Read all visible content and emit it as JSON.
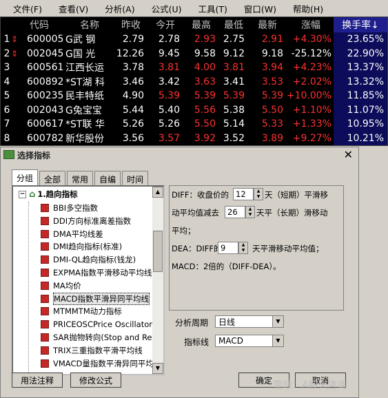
{
  "menu": [
    "文件(F)",
    "查看(V)",
    "分析(A)",
    "公式(U)",
    "工具(T)",
    "窗口(W)",
    "帮助(H)"
  ],
  "quote_table": {
    "headers": [
      "代码",
      "名称",
      "昨收",
      "今开",
      "最高",
      "最低",
      "最新",
      "涨幅",
      "换手率↓"
    ],
    "colors": {
      "up": "#ff3030",
      "down": "#ffffff",
      "green": "#00e000",
      "neutral": "#ffffff",
      "turnover": "#ffffff"
    },
    "rows": [
      {
        "idx": "1",
        "arrow": "⇕",
        "code": "600005",
        "name": "G武 钢",
        "prev": "2.79",
        "open": "2.78",
        "high": "2.93",
        "low": "2.75",
        "last": "2.91",
        "change": "+4.30%",
        "turnover": "23.65%"
      },
      {
        "idx": "2",
        "arrow": "⇕",
        "code": "002045",
        "name": "G国 光",
        "prev": "12.26",
        "open": "9.45",
        "high": "9.58",
        "low": "9.12",
        "last": "9.18",
        "change": "-25.12%",
        "turnover": "22.90%"
      },
      {
        "idx": "3",
        "arrow": "",
        "code": "600561",
        "name": "江西长运",
        "prev": "3.78",
        "open": "3.81",
        "high": "4.00",
        "low": "3.81",
        "last": "3.94",
        "change": "+4.23%",
        "turnover": "13.37%"
      },
      {
        "idx": "4",
        "arrow": "",
        "code": "600892",
        "name": "*ST湖 科",
        "prev": "3.46",
        "open": "3.42",
        "high": "3.63",
        "low": "3.41",
        "last": "3.53",
        "change": "+2.02%",
        "turnover": "13.32%"
      },
      {
        "idx": "5",
        "arrow": "",
        "code": "600235",
        "name": "民丰特纸",
        "prev": "4.90",
        "open": "5.39",
        "high": "5.39",
        "low": "5.39",
        "last": "5.39",
        "change": "+10.00%",
        "turnover": "11.85%"
      },
      {
        "idx": "6",
        "arrow": "",
        "code": "002043",
        "name": "G兔宝宝",
        "prev": "5.44",
        "open": "5.40",
        "high": "5.56",
        "low": "5.38",
        "last": "5.50",
        "change": "+1.10%",
        "turnover": "11.07%"
      },
      {
        "idx": "7",
        "arrow": "",
        "code": "600617",
        "name": "*ST联 华",
        "prev": "5.26",
        "open": "5.26",
        "high": "5.50",
        "low": "5.14",
        "last": "5.33",
        "change": "+1.33%",
        "turnover": "10.95%"
      },
      {
        "idx": "8",
        "arrow": "",
        "code": "600782",
        "name": "新华股份",
        "prev": "3.56",
        "open": "3.57",
        "high": "3.92",
        "low": "3.52",
        "last": "3.89",
        "change": "+9.27%",
        "turnover": "10.21%"
      }
    ]
  },
  "dialog": {
    "title": "选择指标",
    "close": "✕",
    "tabs": [
      "分组",
      "全部",
      "常用",
      "自编",
      "时间"
    ],
    "tree_root": "1.趋向指标",
    "tree_items": [
      "BBI多空指数",
      "DDI方向标准离差指数",
      "DMA平均线差",
      "DMI趋向指标(标准)",
      "DMI-QL趋向指标(钱龙)",
      "EXPMA指数平滑移动平均线",
      "MA均价",
      "MACD指数平滑异同平均线",
      "MTMMTM动力指标",
      "PRICEOSCPrice Oscillator",
      "SAR抛物转向(Stop and Rev",
      "TRIX三重指数平滑平均线",
      "VMACD量指数平滑异同平均线"
    ],
    "selected_item": "MACD指数平滑异同平均线",
    "params": {
      "line1a": "DIFF：收盘价的",
      "short_value": "12",
      "line1b": "天（短期）平滑移",
      "line2a": "动平均值减去",
      "long_value": "26",
      "line2b": "天平（长期）滑移动",
      "line3": "平均；",
      "line4a": "DEA：DIFF的",
      "dea_value": "9",
      "line4b": "天平滑移动平均值；",
      "line5": "MACD：2倍的（DIFF-DEA）。"
    },
    "period_label": "分析周期",
    "period_value": "日线",
    "indicator_label": "指标线",
    "indicator_value": "MACD",
    "buttons": {
      "usage": "用法注释",
      "modify": "修改公式",
      "ok": "确定",
      "cancel": "取消"
    }
  },
  "watermark": "雪球：A股大咨询"
}
